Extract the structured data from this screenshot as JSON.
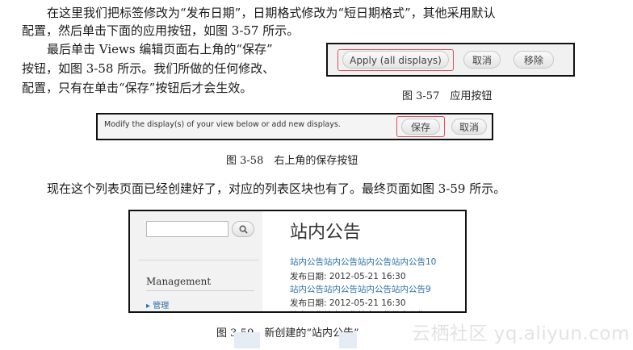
{
  "paragraphs": {
    "p1_line1": "在这里我们把标签修改为“发布日期”，日期格式修改为“短日期格式”，其他采用默认",
    "p1_line2": "配置，然后单击下面的应用按钮，如图 3-57 所示。",
    "p2_line1": "最后单击 Views 编辑页面右上角的“保存”",
    "p2_line2": "按钮，如图 3-58 所示。我们所做的任何修改、",
    "p2_line3": "配置，只有在单击“保存”按钮后才会生效。",
    "p3_line1": "现在这个列表页面已经创建好了，对应的列表区块也有了。最终页面如图 3-59 所示。"
  },
  "fig57": {
    "apply_label": "Apply (all displays)",
    "cancel_label": "取消",
    "remove_label": "移除",
    "caption": "图 3-57　应用按钮"
  },
  "fig58": {
    "message": "Modify the display(s) of your view below or add new displays.",
    "save_label": "保存",
    "cancel_label": "取消",
    "caption": "图 3-58　右上角的保存按钮"
  },
  "fig59": {
    "search_icon": "search-icon",
    "management_heading": "Management",
    "admin_link": "▸ 管理",
    "page_title": "站内公告",
    "items": [
      {
        "title": "站内公告站内公告站内公告站内公告10",
        "date": "发布日期: 2012-05-21 16:30"
      },
      {
        "title": "站内公告站内公告站内公告站内公告9",
        "date": "发布日期: 2012-05-21 16:30"
      }
    ],
    "caption": "图 3-59　新创建的“站内公告”"
  },
  "watermark": "云栖社区 yq.aliyun.com",
  "colors": {
    "link": "#2a6fa8",
    "highlight": "#d9505e",
    "frame": "#111111"
  }
}
